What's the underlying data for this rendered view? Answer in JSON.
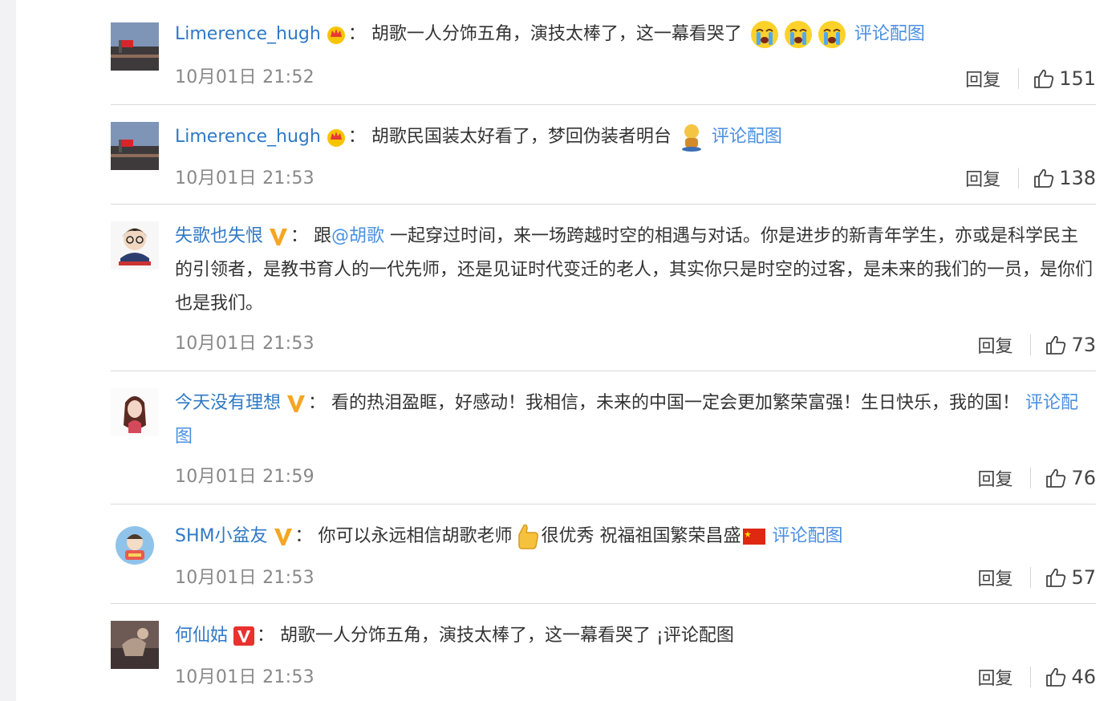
{
  "comments": [
    {
      "user": "Limerence_hugh",
      "parts": {
        "text1": "胡歌一人分饰五角，演技太棒了，这一幕看哭了",
        "link": "评论配图"
      },
      "time": "10月01日 21:52",
      "reply": "回复",
      "likes": "151"
    },
    {
      "user": "Limerence_hugh",
      "parts": {
        "text1": "胡歌民国装太好看了，梦回伪装者明台",
        "link": "评论配图"
      },
      "time": "10月01日 21:53",
      "reply": "回复",
      "likes": "138"
    },
    {
      "user": "失歌也失恨",
      "parts": {
        "text1": "跟",
        "mention": "@胡歌",
        "text2": " 一起穿过时间，来一场跨越时空的相遇与对话。你是进步的新青年学生，亦或是科学民主的引领者，是教书育人的一代先师，还是见证时代变迁的老人，其实你只是时空的过客，是未来的我们的一员，是你们也是我们。"
      },
      "time": "10月01日 21:53",
      "reply": "回复",
      "likes": "73"
    },
    {
      "user": "今天没有理想",
      "parts": {
        "text1": "看的热泪盈眶，好感动！我相信，未来的中国一定会更加繁荣富强！生日快乐，我的国！",
        "link": "评论配图"
      },
      "time": "10月01日 21:59",
      "reply": "回复",
      "likes": "76"
    },
    {
      "user": "SHM小盆友",
      "parts": {
        "text1": "你可以永远相信胡歌老师",
        "text2": "很优秀 祝福祖国繁荣昌盛",
        "link": "评论配图"
      },
      "time": "10月01日 21:53",
      "reply": "回复",
      "likes": "57"
    },
    {
      "user": "何仙姑",
      "parts": {
        "text1": "胡歌一人分饰五角，演技太棒了，这一幕看哭了 ¡评论配图"
      },
      "time": "10月01日 21:53",
      "reply": "回复",
      "likes": "46"
    }
  ],
  "colors": {
    "username": "#2f79c6",
    "link": "#4a90e2",
    "text": "#333333",
    "time": "#888888",
    "divider": "#d9d9d9",
    "verified_yellow": "#f5a623",
    "verified_red": "#e8322e"
  },
  "icons": {
    "crown": "crown-badge-icon",
    "verified": "verified-v-icon",
    "like": "thumbs-up-icon",
    "cry": "crying-face-icon",
    "thumb_emoji": "thumbs-up-emoji-icon",
    "flag": "china-flag-icon"
  }
}
